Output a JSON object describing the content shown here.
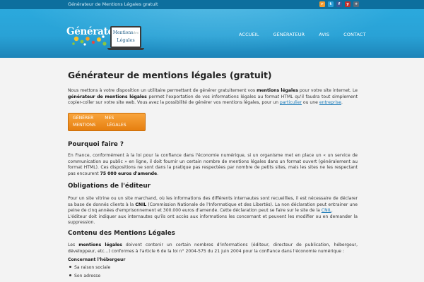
{
  "topbar": {
    "title": "Générateur de Mentions Légales gratuit",
    "social": [
      {
        "icon": "rss-icon",
        "letter": "r",
        "color": "#f39c2f"
      },
      {
        "icon": "twitter-icon",
        "letter": "t",
        "color": "#2b9ed8"
      },
      {
        "icon": "facebook-icon",
        "letter": "f",
        "color": "#3b5998"
      },
      {
        "icon": "youtube-icon",
        "letter": "y",
        "color": "#c4302b"
      },
      {
        "icon": "plus-icon",
        "letter": "+",
        "color": "#5a6a7a"
      }
    ]
  },
  "header": {
    "logo_text": "Générateur",
    "logo_screen_line1": "Mentions",
    "logo_screen_line1_small": "des",
    "logo_screen_line2": "Légales",
    "nav": [
      "ACCUEIL",
      "GÉNÉRATEUR",
      "AVIS",
      "CONTACT"
    ]
  },
  "main": {
    "title": "Générateur de mentions légales (gratuit)",
    "intro_1": "Nous mettons à votre disposition un utilitaire permettant de générer gratuitement vos",
    "intro_bold_1": "mentions légales",
    "intro_2": "pour votre site internet. Le",
    "intro_bold_2": "générateur de mentions légales",
    "intro_3": "permet l'exportation de vos informations légales au format HTML qu'il faudra tout simplement copier-coller sur votre site web. Vous avez la possibilité de générer vos mentions légales, pour un",
    "intro_link_1": "particulier",
    "intro_4": "ou une",
    "intro_link_2": "entreprise",
    "intro_5": ".",
    "cta_label": "GÉNÉRER MES MENTIONS LÉGALES",
    "why": {
      "heading": "Pourquoi faire ?",
      "text": "En France, conformément à la loi pour la confiance dans l'économie numérique, si un organisme met en place un « un service de communication au public » en ligne, il doit fournir un certain nombre de mentions légales dans un format ouvert (généralement au format HTML). Ces dispositions ne sont dans la pratique pas respectées par nombre de petits sites, mais les sites ne les respectant pas encourent",
      "text_bold": "75 000 euros d'amende",
      "text_end": "."
    },
    "obligations": {
      "heading": "Obligations de l'éditeur",
      "text_1": "Pour un site vitrine ou un site marchand, où les informations des différents internautes sont recueillies, il est nécessaire de déclarer sa base de donnés clients à la",
      "cnil": "CNIL",
      "text_2": "(Commission Nationale de l'Informatique et des Libertés). La non déclaration peut entrainer une peine de cinq années d'emprisonnement et 300.000 euros d'amende. Cette déclaration peut se faire sur le site de la",
      "cnil_link": "CNIL",
      "text_3": ".",
      "text_4": "L'éditeur doit indiquer aux internautes qu'ils ont accès aux informations les concernant et peuvent les modifier ou en demander la suppression."
    },
    "content": {
      "heading": "Contenu des Mentions Légales",
      "text_1": "Les",
      "text_bold": "mentions légales",
      "text_2": "doivent contenir un certain nombres d'informations (éditeur, directeur de publication, hébergeur, développeur, etc...) conformes à l'article 6 de la loi n° 2004-575 du 21 juin 2004 pour la confiance dans l'économie numérique :",
      "subheading": "Concernant l'hébergeur",
      "items": [
        "Sa raison sociale",
        "Son adresse"
      ]
    }
  }
}
